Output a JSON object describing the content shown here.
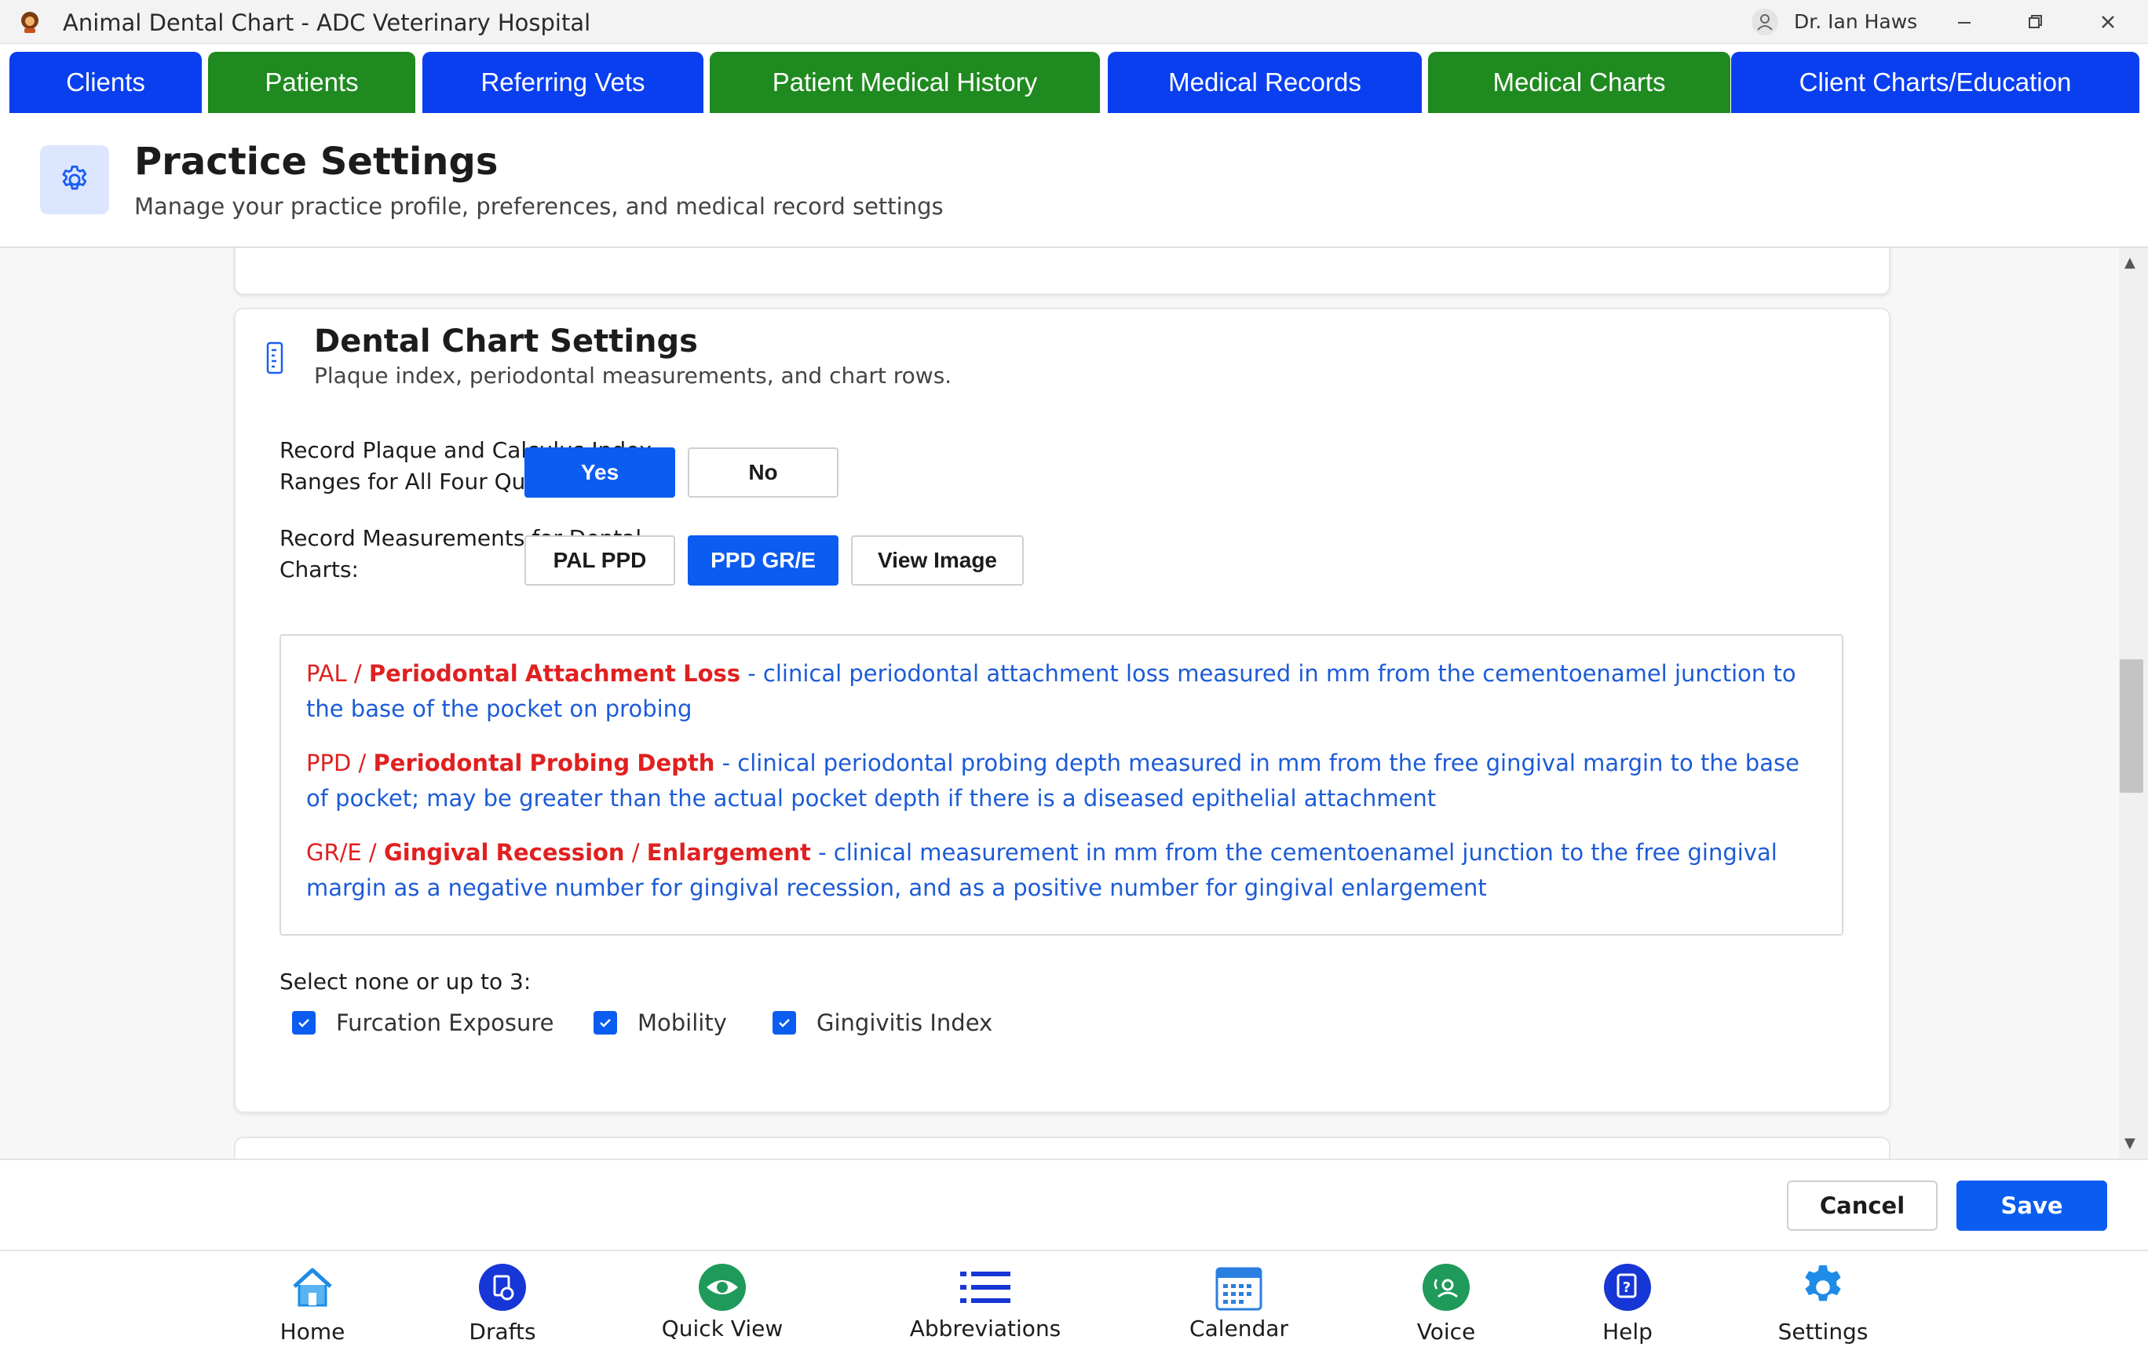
{
  "window": {
    "title": "Animal Dental Chart - ADC Veterinary Hospital",
    "user": "Dr. Ian Haws"
  },
  "tabs": [
    {
      "label": "Clients",
      "color": "#0a3ff0"
    },
    {
      "label": "Patients",
      "color": "#1f8a1f"
    },
    {
      "label": "Referring Vets",
      "color": "#0a3ff0"
    },
    {
      "label": "Patient Medical History",
      "color": "#1f8a1f"
    },
    {
      "label": "Medical Records",
      "color": "#0a3ff0"
    },
    {
      "label": "Medical Charts",
      "color": "#1f8a1f"
    },
    {
      "label": "Client Charts/Education",
      "color": "#0a3ff0"
    }
  ],
  "header": {
    "title": "Practice Settings",
    "subtitle": "Manage your practice profile, preferences, and medical record settings",
    "icon": "gear-icon"
  },
  "dental_section": {
    "title": "Dental Chart Settings",
    "subtitle": "Plaque index, periodontal measurements, and chart rows.",
    "icon": "ruler-icon",
    "plaque_label_line1": "Record Plaque and Calculus Index",
    "plaque_label_line2": "Ranges for All Four Quadrants:",
    "plaque_yes": "Yes",
    "plaque_no": "No",
    "plaque_selected": "Yes",
    "measure_label_line1": "Record Measurements for Dental",
    "measure_label_line2": "Charts:",
    "measure_pal": "PAL PPD",
    "measure_ppd": "PPD GR/E",
    "measure_selected": "PPD GR/E",
    "view_image": "View Image",
    "definitions": [
      {
        "term": "PAL / Periodontal Attachment Loss",
        "text": " - clinical periodontal attachment loss measured in mm from the cementoenamel junction to the base of the pocket on probing"
      },
      {
        "term": "PPD / Periodontal Probing Depth",
        "text": " - clinical periodontal probing depth measured in mm from the free gingival margin to the base of pocket; may be greater than the actual pocket depth if there is a diseased epithelial attachment"
      },
      {
        "term": "GR/E / Gingival Recession / Enlargement",
        "text": " - clinical measurement in mm from the cementoenamel junction to the free gingival margin as a negative number for gingival recession, and as a positive number for gingival enlargement"
      }
    ],
    "select_label": "Select none or up to 3:",
    "checkboxes": [
      {
        "label": "Furcation Exposure",
        "checked": true
      },
      {
        "label": "Mobility",
        "checked": true
      },
      {
        "label": "Gingivitis Index",
        "checked": true
      }
    ]
  },
  "footer": {
    "cancel": "Cancel",
    "save": "Save"
  },
  "bottom_nav": [
    {
      "label": "Home",
      "icon": "home-icon"
    },
    {
      "label": "Drafts",
      "icon": "drafts-icon"
    },
    {
      "label": "Quick View",
      "icon": "eye-icon"
    },
    {
      "label": "Abbreviations",
      "icon": "list-icon"
    },
    {
      "label": "Calendar",
      "icon": "calendar-icon"
    },
    {
      "label": "Voice",
      "icon": "voice-icon"
    },
    {
      "label": "Help",
      "icon": "help-icon"
    },
    {
      "label": "Settings",
      "icon": "settings-gear-icon"
    }
  ]
}
